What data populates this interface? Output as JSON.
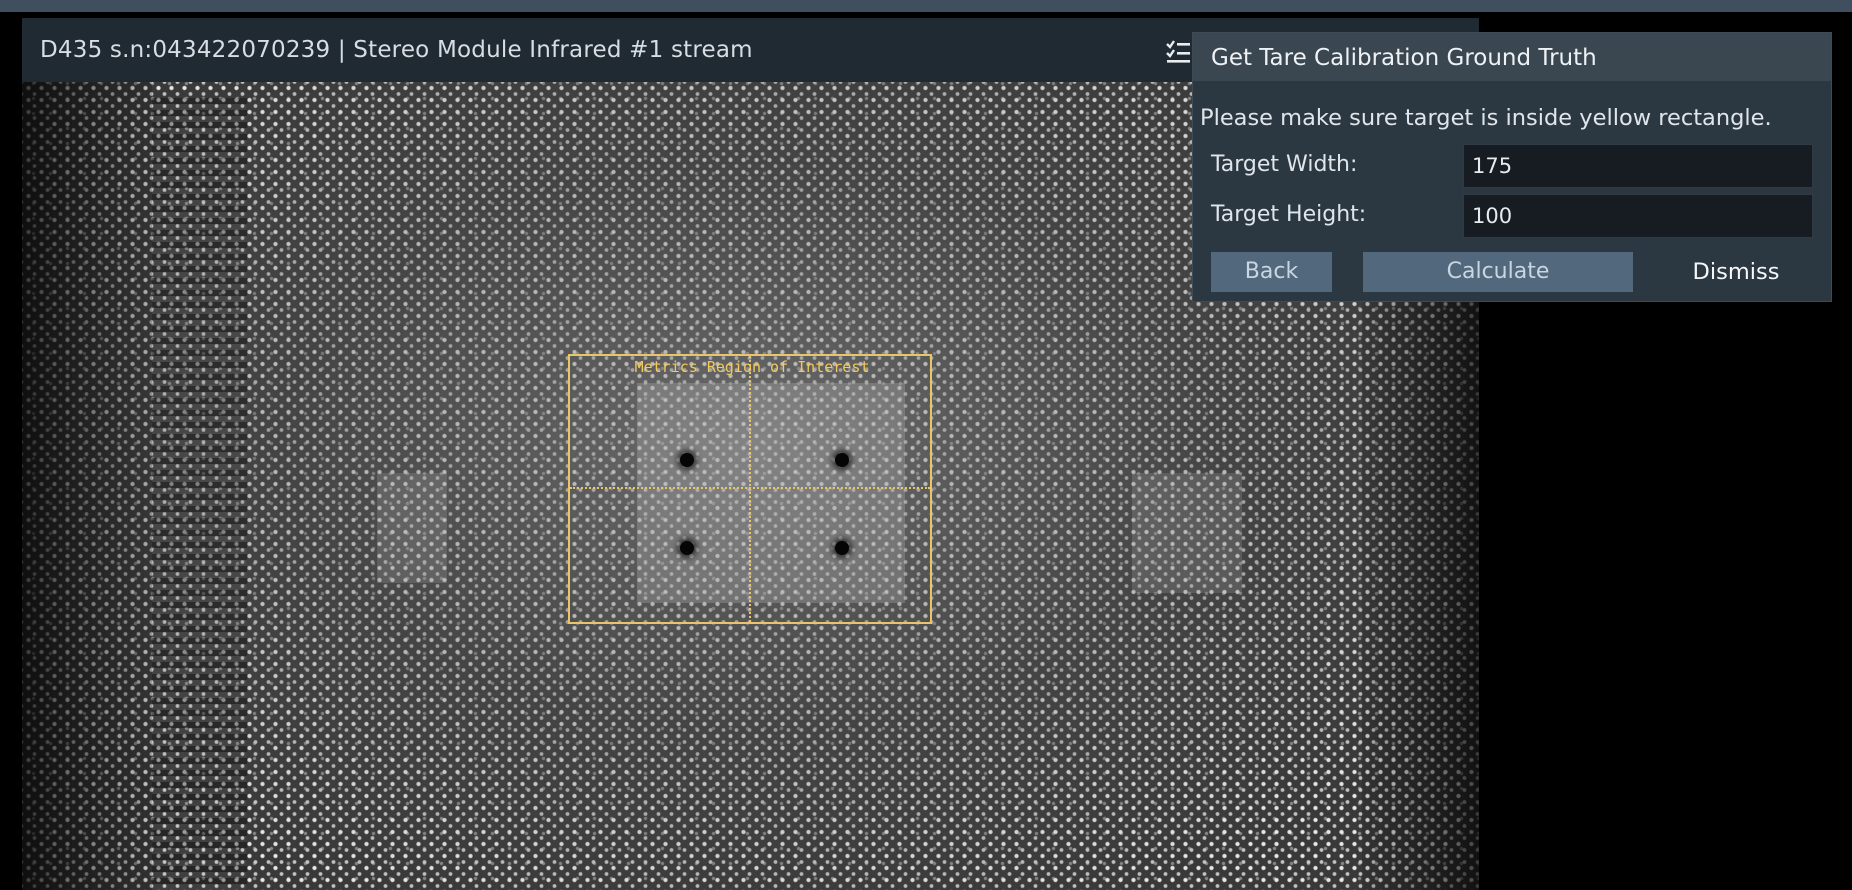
{
  "stream": {
    "title": "D435 s.n:043422070239 | Stereo Module Infrared #1 stream",
    "options_icon": "checklist-icon",
    "roi_label": "Metrics Region of Interest",
    "roi_color": "#e9c46a"
  },
  "dialog": {
    "title": "Get Tare Calibration Ground Truth",
    "message": "Please make sure target is inside yellow rectangle.",
    "fields": [
      {
        "label": "Target Width:",
        "value": "175"
      },
      {
        "label": "Target Height:",
        "value": "100"
      }
    ],
    "buttons": {
      "back": "Back",
      "calculate": "Calculate",
      "dismiss": "Dismiss"
    }
  },
  "colors": {
    "accent_button": "#52687c",
    "dialog_bg": "#2c3841",
    "header_bg": "#202a33"
  }
}
